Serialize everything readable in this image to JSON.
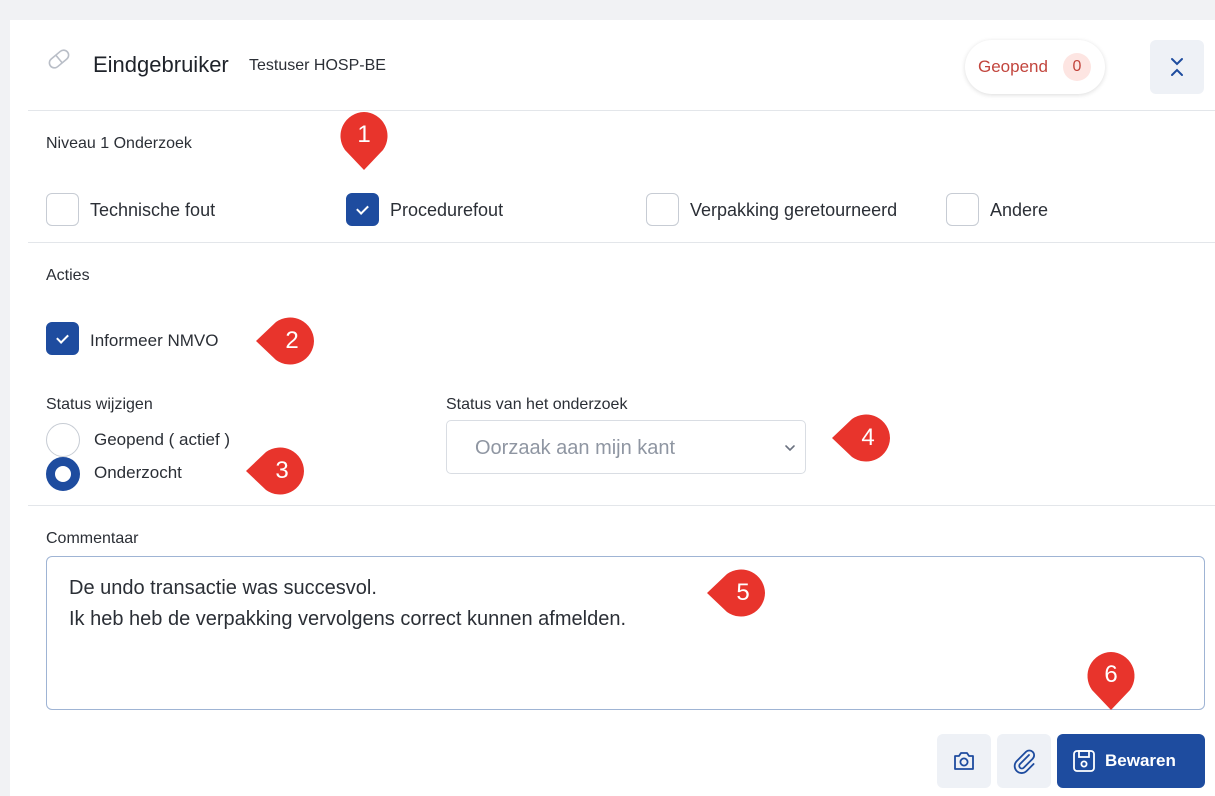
{
  "header": {
    "title": "Eindgebruiker",
    "subtitle": "Testuser HOSP-BE",
    "status_label": "Geopend",
    "status_count": "0"
  },
  "niveau": {
    "label": "Niveau 1 Onderzoek",
    "options": [
      {
        "label": "Technische fout",
        "checked": false
      },
      {
        "label": "Procedurefout",
        "checked": true
      },
      {
        "label": "Verpakking geretourneerd",
        "checked": false
      },
      {
        "label": "Andere",
        "checked": false
      }
    ]
  },
  "acties": {
    "label": "Acties",
    "informeer_label": "Informeer NMVO",
    "informeer_checked": true
  },
  "status": {
    "label": "Status wijzigen",
    "options": [
      {
        "label": "Geopend ( actief )",
        "selected": false
      },
      {
        "label": "Onderzocht",
        "selected": true
      }
    ]
  },
  "onderzoek": {
    "label": "Status van het onderzoek",
    "selected_value": "Oorzaak aan mijn kant"
  },
  "commentaar": {
    "label": "Commentaar",
    "lines": [
      "De undo transactie was succesvol.",
      "Ik heb heb de verpakking vervolgens correct kunnen afmelden."
    ]
  },
  "actions": {
    "save_label": "Bewaren"
  },
  "markers": [
    "1",
    "2",
    "3",
    "4",
    "5",
    "6"
  ],
  "colors": {
    "primary": "#1e4c9f",
    "status_text": "#c2453d",
    "marker": "#e8342c"
  }
}
